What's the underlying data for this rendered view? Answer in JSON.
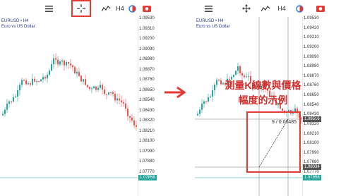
{
  "left_panel": {
    "toolbar": {
      "timeframe": "H4"
    },
    "symbol": "EURUSD • H4",
    "description": "Euro vs US Dollar",
    "price_labels": [
      "1.09530",
      "1.09310",
      "1.09200",
      "1.09090",
      "1.08980",
      "1.08870",
      "1.08760",
      "1.08650",
      "1.08540",
      "1.08430",
      "1.08320",
      "1.08210",
      "1.08100",
      "1.07990",
      "1.07880",
      "1.07770"
    ],
    "current_price": "1.07858",
    "bottom_price": "1.07770"
  },
  "right_panel": {
    "toolbar": {
      "timeframe": "H4"
    },
    "symbol": "EURUSD • H4",
    "description": "Euro vs US Dollar",
    "price_labels": [
      "1.09530",
      "1.09420",
      "1.09310",
      "1.09200",
      "1.09090",
      "1.08980",
      "1.08870",
      "1.08760",
      "1.08650",
      "1.08540",
      "1.08430",
      "1.08320",
      "1.08210",
      "1.08100",
      "1.07990",
      "1.07880",
      "1.07770"
    ],
    "crosshair_price": "1.08516",
    "crosshair_price_lower": "1.08034",
    "current_price": "1.07858",
    "measure_label": "9 / 0.00485"
  },
  "annotation": {
    "line1": "測量K線數與價格",
    "line2": "幅度的示例"
  },
  "colors": {
    "up": "#26a69a",
    "down": "#ef5350",
    "highlight": "#e53935",
    "text": "#333333",
    "symbol": "#2a3a8f"
  },
  "icons": [
    "menu-icon",
    "crosshair-icon",
    "indicators-icon",
    "timeframe-label",
    "color-circle-icon",
    "camera-icon",
    "move-icon",
    "right-arrow-icon"
  ]
}
